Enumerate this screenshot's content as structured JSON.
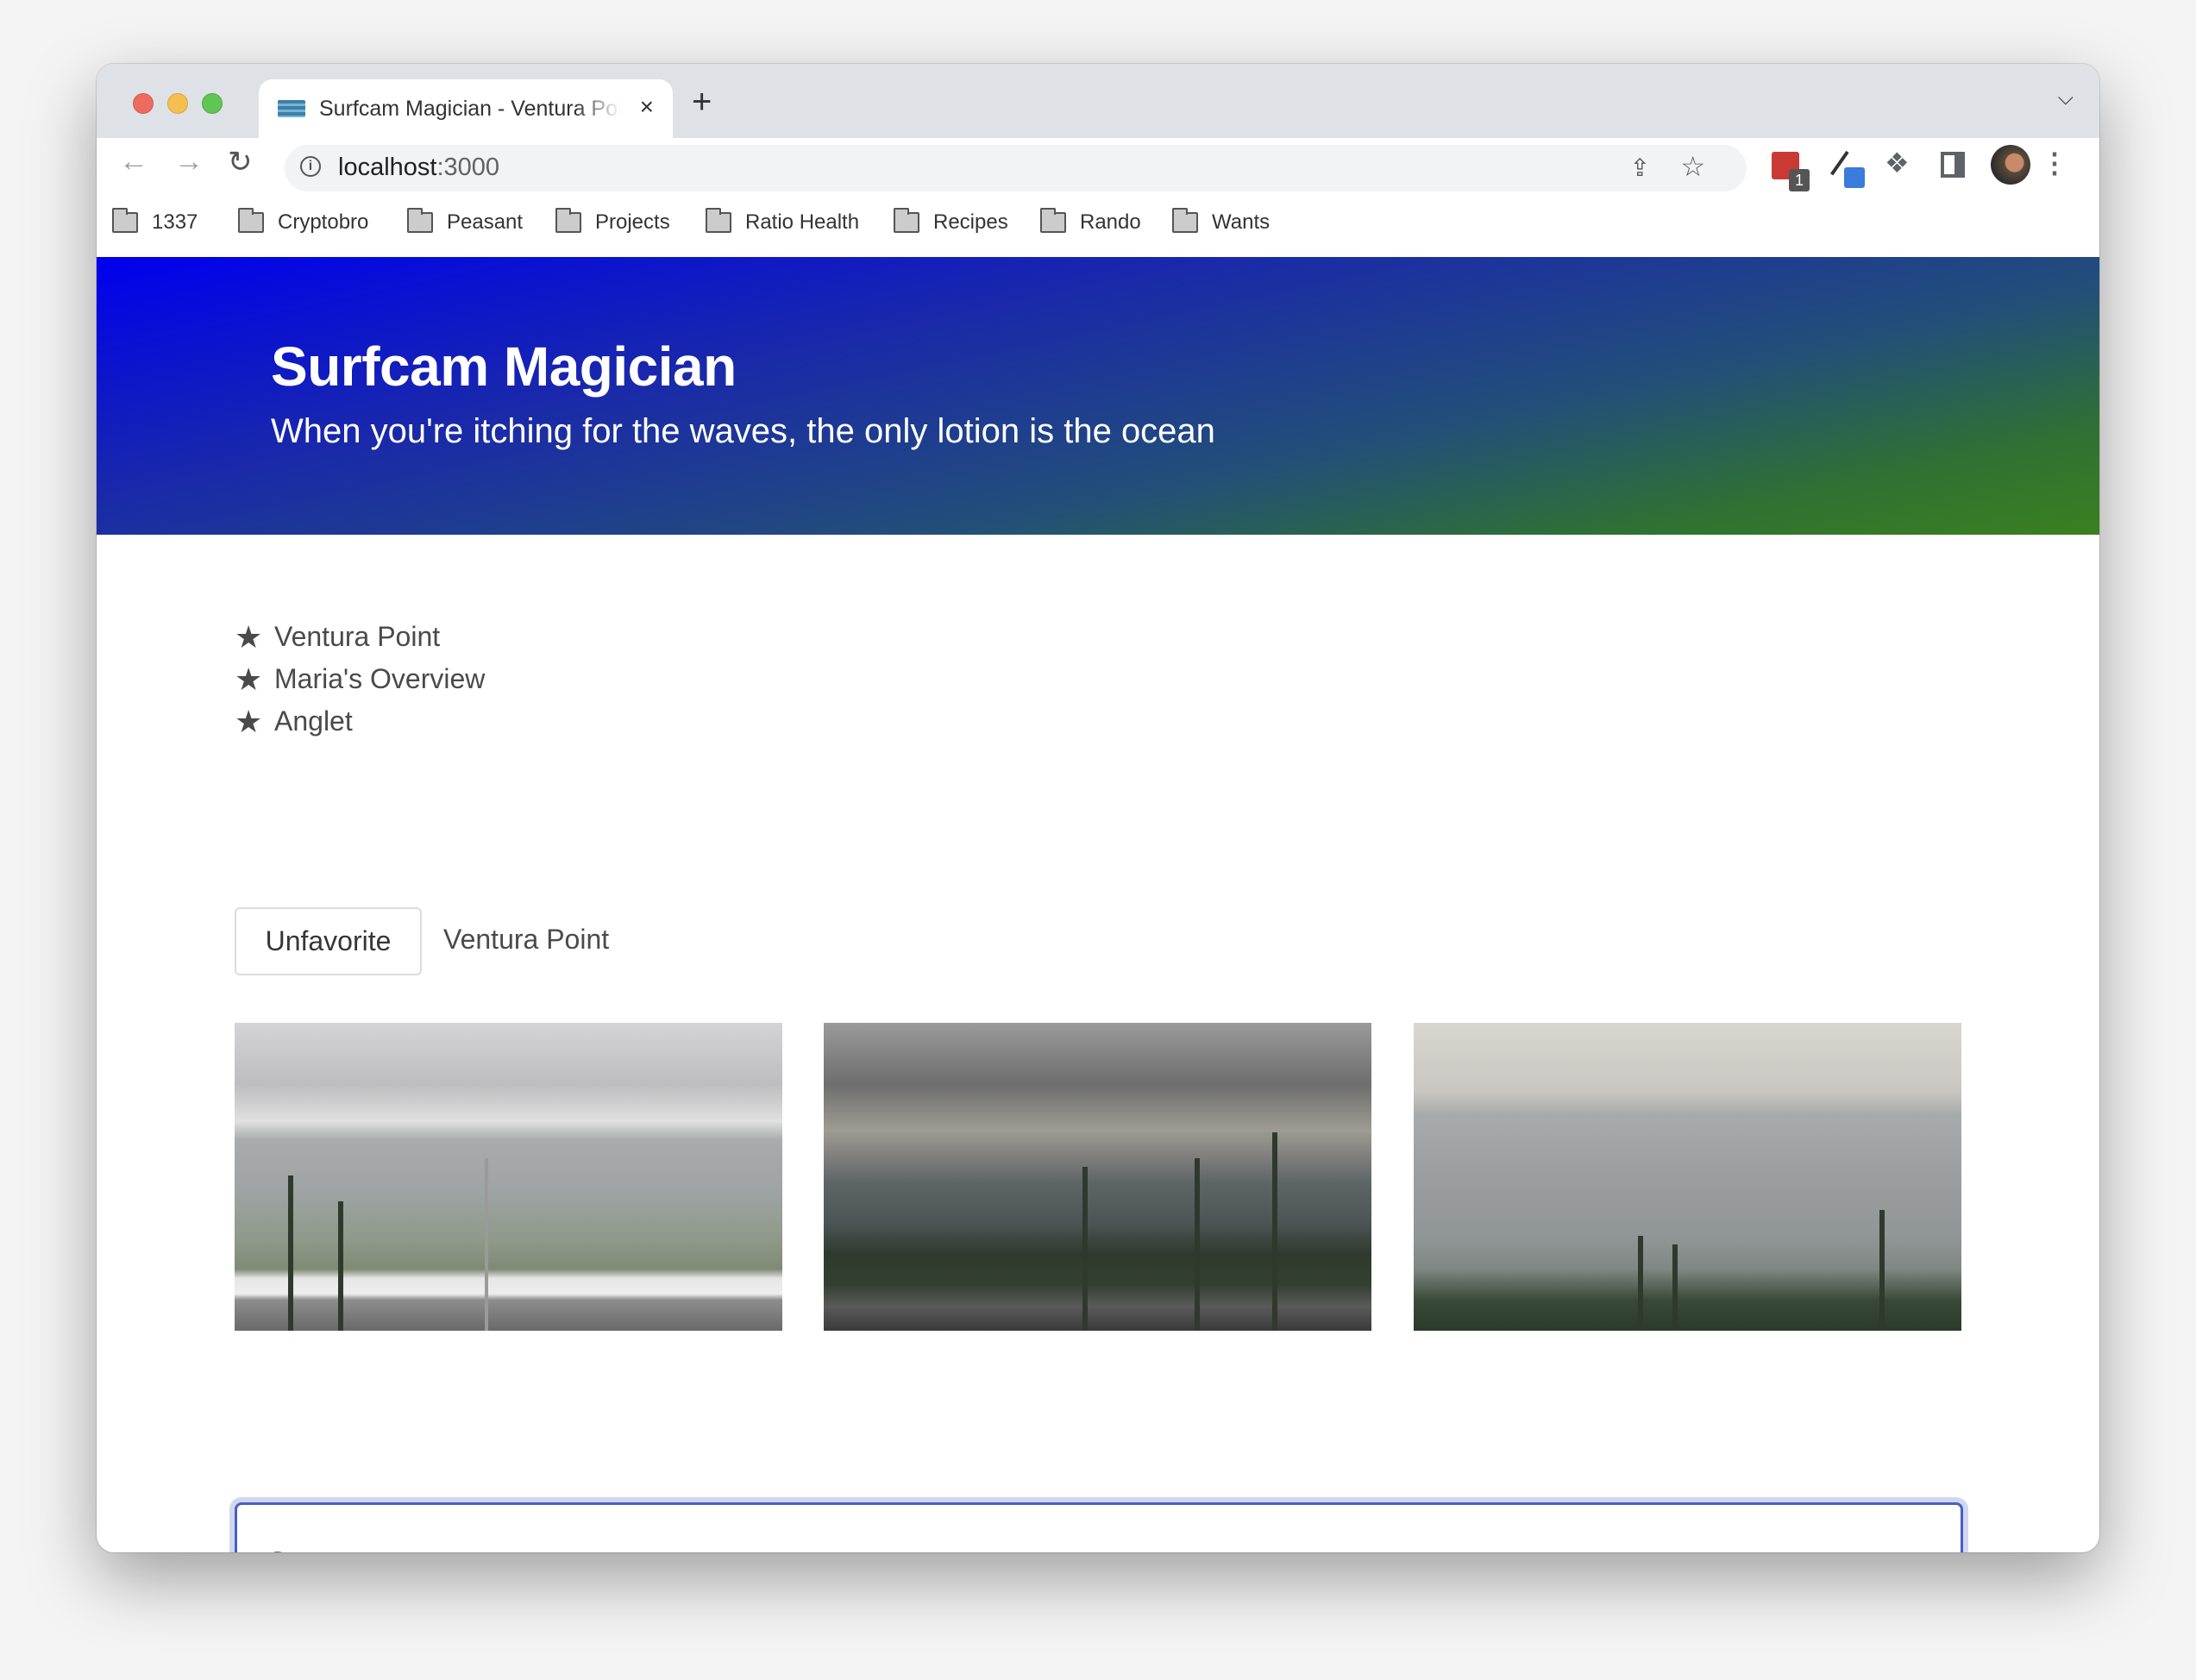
{
  "browser": {
    "tab": {
      "title": "Surfcam Magician - Ventura Point",
      "favicon": "wave-icon",
      "close": "×"
    },
    "new_tab": "+",
    "dropdown": "⌄",
    "url_host": "localhost",
    "url_port": ":3000",
    "extensions": {
      "lastpass_badge": "1"
    },
    "bookmarks": [
      "1337",
      "Cryptobro",
      "Peasant",
      "Projects",
      "Ratio Health",
      "Recipes",
      "Rando",
      "Wants"
    ]
  },
  "banner": {
    "title": "Surfcam Magician",
    "subtitle": "When you're itching for the waves, the only lotion is the ocean",
    "gradient_start": "#0000ee",
    "gradient_end": "#3a8020"
  },
  "favorites": [
    {
      "icon": "star-icon",
      "label": "Ventura Point"
    },
    {
      "icon": "star-icon",
      "label": "Maria's Overview"
    },
    {
      "icon": "star-icon",
      "label": "Anglet"
    }
  ],
  "current_cam": {
    "unfavorite_label": "Unfavorite",
    "name": "Ventura Point",
    "images": [
      {
        "alt": "Ventura Point surf cam view 1"
      },
      {
        "alt": "Ventura Point surf cam view 2"
      },
      {
        "alt": "Ventura Point surf cam view 3"
      }
    ]
  },
  "input": {
    "value": "S"
  }
}
